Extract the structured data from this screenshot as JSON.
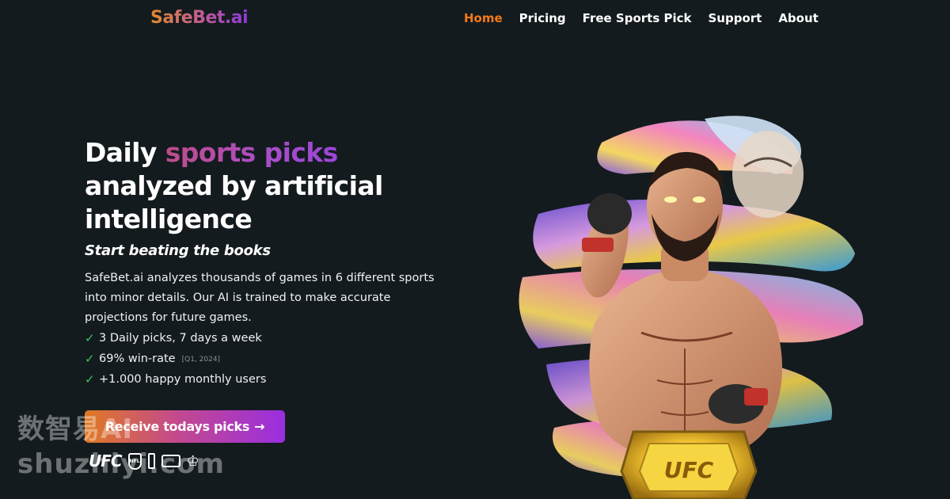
{
  "brand": {
    "logo_text": "SafeBet.ai"
  },
  "nav": {
    "items": [
      {
        "label": "Home",
        "active": true
      },
      {
        "label": "Pricing",
        "active": false
      },
      {
        "label": "Free Sports Pick",
        "active": false
      },
      {
        "label": "Support",
        "active": false
      },
      {
        "label": "About",
        "active": false
      }
    ]
  },
  "hero": {
    "headline_pre": "Daily ",
    "headline_accent": "sports picks",
    "headline_post": " analyzed by artificial intelligence",
    "subhead": "Start beating the books",
    "description": "SafeBet.ai analyzes thousands of games in 6 different sports into minor details. Our AI is trained to make accurate projections for future games.",
    "checks": [
      {
        "text": "3 Daily picks, 7 days a week",
        "note": ""
      },
      {
        "text": "69% win-rate",
        "note": "[Q1, 2024]"
      },
      {
        "text": "+1.000 happy monthly users",
        "note": ""
      }
    ],
    "cta_label": "Receive todays picks",
    "cta_arrow": "→"
  },
  "leagues": {
    "ufc": "UFC",
    "nfl": "NFL",
    "icons": [
      "ufc-logo",
      "nfl-logo",
      "nba-logo",
      "mlb-logo",
      "premier-league-logo"
    ]
  },
  "watermark": {
    "line1": "数智易AI",
    "line2": "shuzhiyi.com"
  },
  "art": {
    "belt_text": "UFC"
  },
  "colors": {
    "background": "#141b1f",
    "nav_active": "#f07a1a",
    "check": "#35c75a",
    "gradient_start": "#e07a22",
    "gradient_mid": "#c44a8c",
    "gradient_end": "#9a2ee0"
  }
}
